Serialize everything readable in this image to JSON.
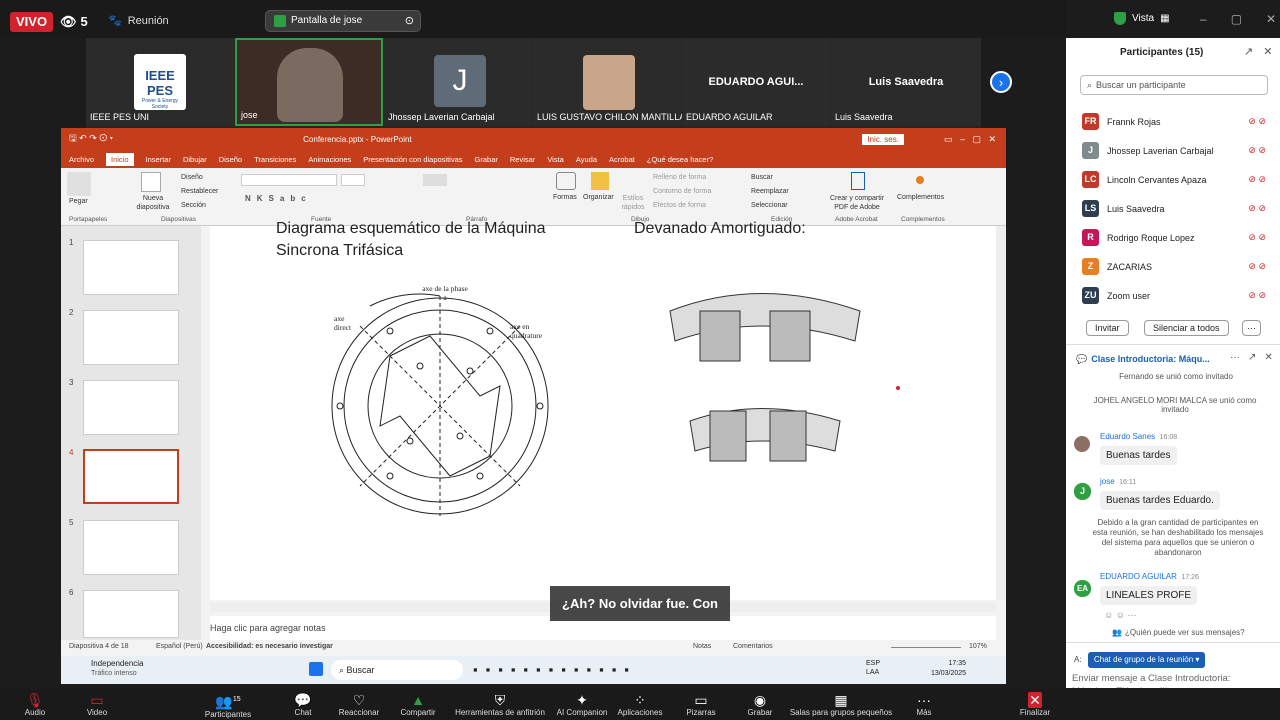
{
  "topbar": {
    "live_label": "VIVO",
    "viewer_count": "5",
    "meeting_label": "Reunión",
    "share_label": "Pantalla de jose",
    "view_label": "Vista"
  },
  "gallery": {
    "tiles": [
      {
        "name": "IEEE PES UNI",
        "logo_title": "IEEE PES",
        "logo_sub": "Power & Energy Society"
      },
      {
        "name": "jose"
      },
      {
        "name": "Jhossep Laverian Carbajal",
        "initial": "J"
      },
      {
        "name": "LUIS GUSTAVO CHILON MANTILLA"
      },
      {
        "name": "EDUARDO AGUILAR",
        "big": "EDUARDO AGUI..."
      },
      {
        "name": "Luis Saavedra",
        "big": "Luis Saavedra"
      }
    ]
  },
  "participants": {
    "header": "Participantes (15)",
    "search_placeholder": "Buscar un participante",
    "list": [
      {
        "initials": "FR",
        "name": "Frannk Rojas",
        "color": "#c0392b"
      },
      {
        "initials": "J",
        "name": "Jhossep Laverian Carbajal",
        "color": "#7f8c8d"
      },
      {
        "initials": "LC",
        "name": "Lincoln Cervantes Apaza",
        "color": "#c0392b"
      },
      {
        "initials": "LS",
        "name": "Luis Saavedra",
        "color": "#2c3e50"
      },
      {
        "initials": "R",
        "name": "Rodrigo Roque Lopez",
        "color": "#c2185b"
      },
      {
        "initials": "Z",
        "name": "ZACARIAS",
        "color": "#e67e22"
      },
      {
        "initials": "ZU",
        "name": "Zoom user",
        "color": "#2c3e50"
      }
    ],
    "invite_label": "Invitar",
    "mute_all_label": "Silenciar a todos"
  },
  "chat": {
    "header": "Clase Introductoria: Máqu...",
    "joined_1": "Fernando se unió como invitado",
    "joined_2": "JOHEL ANGELO MORI MALCA se unió como invitado",
    "messages": [
      {
        "name": "Eduardo Sanes",
        "time": "16:08",
        "text": "Buenas tardes",
        "initials": ""
      },
      {
        "name": "jose",
        "time": "16:11",
        "text": "Buenas tardes Eduardo.",
        "initials": "J"
      },
      {
        "name": "EDUARDO AGUILAR",
        "time": "17:26",
        "text": "LINEALES PROFE",
        "initials": "EA"
      }
    ],
    "system_note": "Debido a la gran cantidad de participantes en esta reunión, se han deshabilitado los mensajes del sistema para aquellos que se unieron o abandonaron",
    "who_can_see": "¿Quién puede ver sus mensajes?",
    "to_label": "A:",
    "to_target": "Chat de grupo de la reunión",
    "input_placeholder": "Enviar mensaje a Clase Introductoria: Máquinas Eléctricas III"
  },
  "ppt": {
    "title": "Conferencia.pptx - PowerPoint",
    "signin": "Inic. ses.",
    "tabs": [
      "Archivo",
      "Inicio",
      "Insertar",
      "Dibujar",
      "Diseño",
      "Transiciones",
      "Animaciones",
      "Presentación con diapositivas",
      "Grabar",
      "Revisar",
      "Vista",
      "Ayuda",
      "Acrobat",
      "¿Qué desea hacer?"
    ],
    "ribbon": {
      "paste": "Pegar",
      "new_slide": "Nueva diapositiva",
      "layout": "Diseño",
      "reset": "Restablecer",
      "section": "Sección",
      "groups": [
        "Portapapeles",
        "Diapositivas",
        "Fuente",
        "Párrafo",
        "Dibujo",
        "Edición",
        "Adobe Acrobat",
        "Complementos"
      ],
      "shapes": "Formas",
      "arrange": "Organizar",
      "quick_styles": "Estilos rápidos",
      "fill": "Relleno de forma",
      "outline": "Contorno de forma",
      "effects": "Efectos de forma",
      "find": "Buscar",
      "replace": "Reemplazar",
      "select": "Seleccionar",
      "adobe": "Crear y compartir PDF de Adobe",
      "addins": "Complementos"
    },
    "slide": {
      "title_left": "Diagrama esquemático de la Máquina Sincrona Trifásica",
      "title_right": "Devanado Amortiguado:",
      "label_axe_phase": "axe de la phase a",
      "label_axe_direct": "axe direct",
      "label_axe_quad": "axe en quadrature"
    },
    "thumbs": [
      "1",
      "2",
      "3",
      "4",
      "5",
      "6"
    ],
    "notes_placeholder": "Haga clic para agregar notas",
    "status": {
      "slide_count": "Diapositiva 4 de 18",
      "language": "Español (Perú)",
      "accessibility": "Accesibilidad: es necesario investigar",
      "notes": "Notas",
      "comments": "Comentarios",
      "zoom": "107%"
    }
  },
  "caption": "¿Ah? No olvidar fue. Con",
  "taskbar": {
    "weather_1": "Independencia",
    "weather_2": "Tráfico intenso",
    "search": "Buscar",
    "lang": "ESP LAA",
    "time": "17:35",
    "date": "13/03/2025"
  },
  "zoombar": {
    "items": [
      "Audio",
      "Video",
      "Participantes",
      "Chat",
      "Reaccionar",
      "Compartir",
      "Herramientas de anfitrión",
      "AI Companion",
      "Aplicaciones",
      "Pizarras",
      "Grabar",
      "Salas para grupos pequeños",
      "Más"
    ],
    "participants_count": "15",
    "end": "Finalizar"
  }
}
